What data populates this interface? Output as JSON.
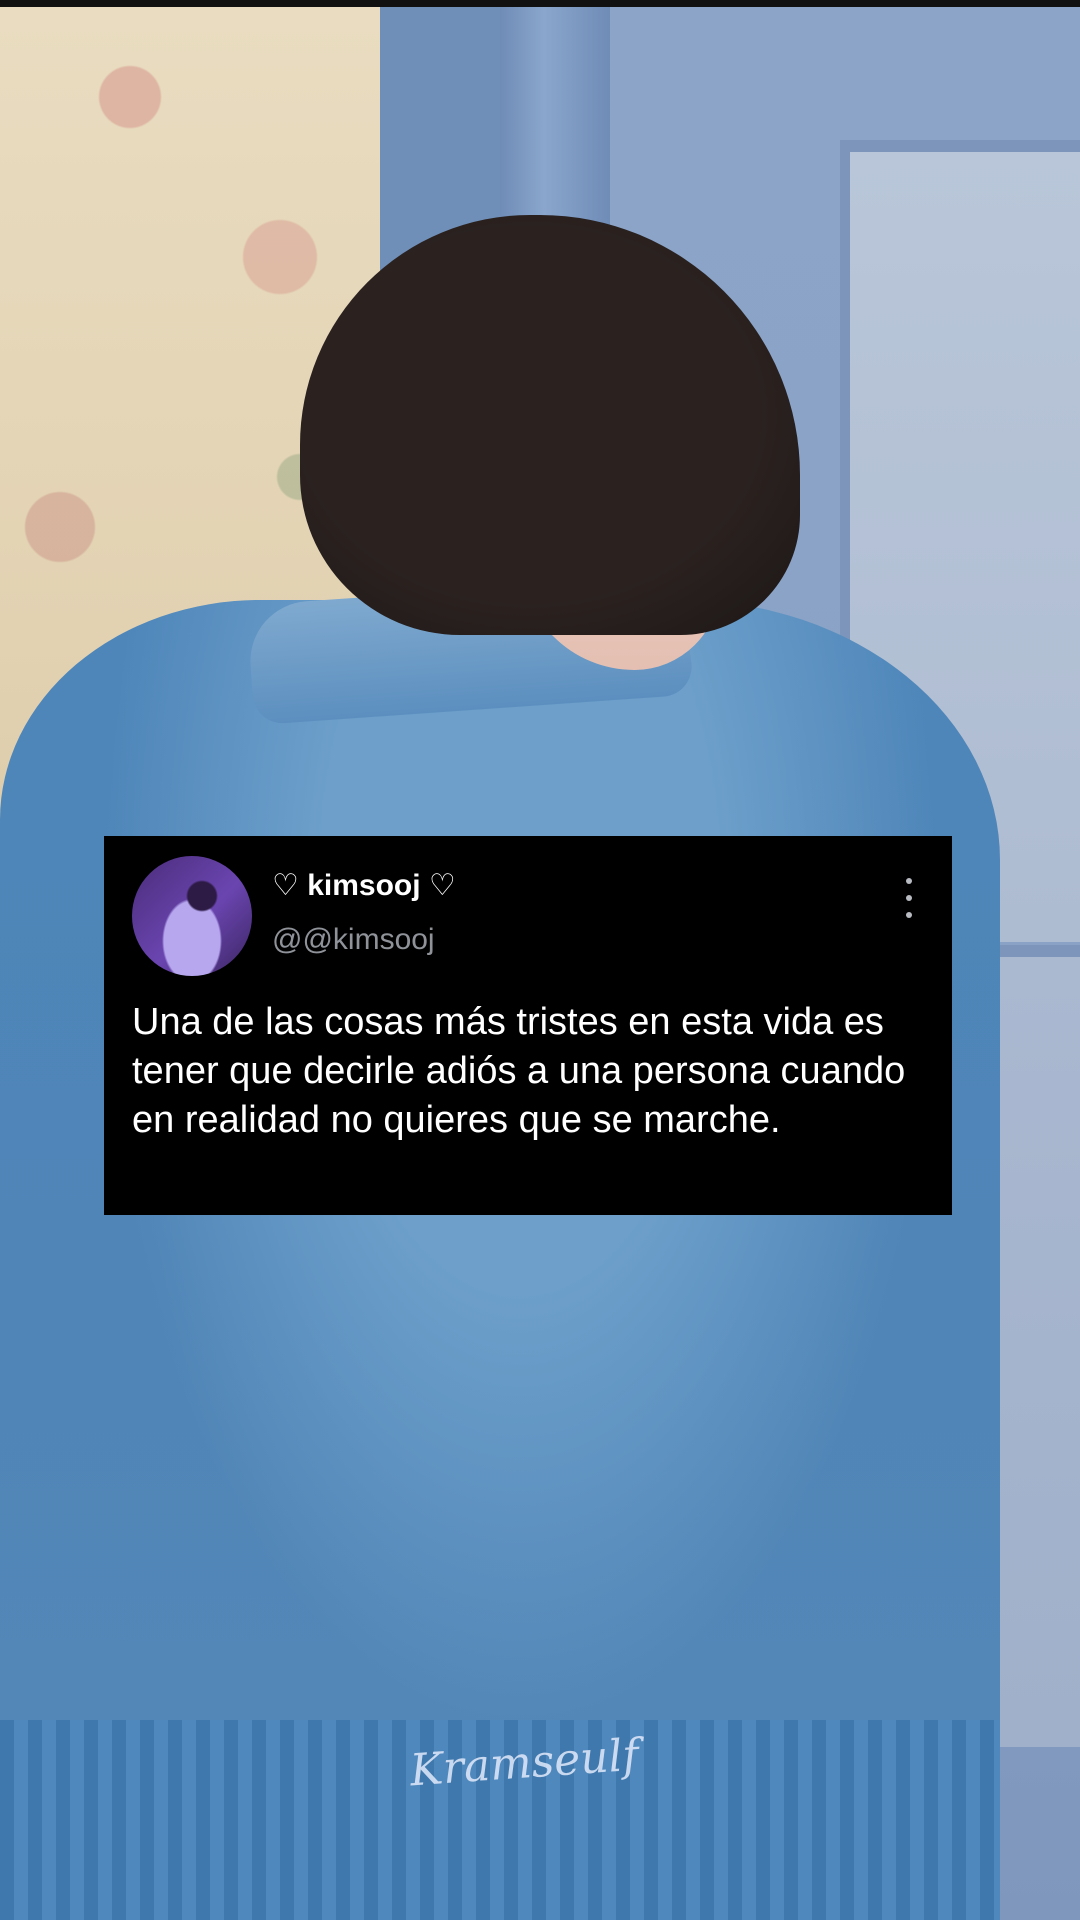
{
  "tweet": {
    "display_name": "♡ kimsooj ♡",
    "handle": "@@kimsooj",
    "text": "Una de las cosas más tristes en esta vida es tener que decirle adiós a una persona cuando en realidad no quieres que se marche.",
    "avatar_icon": "avatar-image",
    "more_icon": "more-vertical-icon"
  },
  "background": {
    "watermark": "Kramseulf",
    "palette": {
      "jacket": "#4f85b7",
      "door": "#8aa2c6",
      "wallpaper": "#e2d2b2",
      "card": "#000000",
      "handle_text": "#8f9399"
    }
  }
}
